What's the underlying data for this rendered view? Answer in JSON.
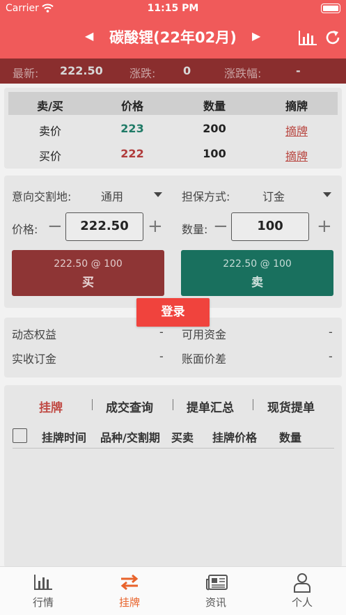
{
  "status": {
    "carrier": "Carrier",
    "time": "11:15 PM"
  },
  "nav": {
    "title": "碳酸锂(22年02月)",
    "prev_icon": "caret-left-icon",
    "next_icon": "caret-right-icon",
    "chart_icon": "bar-chart-icon",
    "refresh_icon": "refresh-icon"
  },
  "quote": {
    "latest_label": "最新:",
    "latest_value": "222.50",
    "change_label": "涨跌:",
    "change_value": "0",
    "pct_label": "涨跌幅:",
    "pct_value": "-"
  },
  "book": {
    "headers": [
      "卖/买",
      "价格",
      "数量",
      "摘牌"
    ],
    "rows": [
      {
        "side": "卖价",
        "price": "223",
        "qty": "200",
        "action": "摘牌"
      },
      {
        "side": "买价",
        "price": "222",
        "qty": "100",
        "action": "摘牌"
      }
    ]
  },
  "form": {
    "delivery_label": "意向交割地:",
    "delivery_value": "通用",
    "guarantee_label": "担保方式:",
    "guarantee_value": "订金",
    "price_label": "价格:",
    "price_value": "222.50",
    "qty_label": "数量:",
    "qty_value": "100",
    "buy_sub": "222.50 @ 100",
    "buy_label": "买",
    "sell_sub": "222.50 @ 100",
    "sell_label": "卖"
  },
  "login_label": "登录",
  "account": {
    "equity_label": "动态权益",
    "equity_value": "-",
    "avail_label": "可用资金",
    "avail_value": "-",
    "deposit_label": "实收订金",
    "deposit_value": "-",
    "diff_label": "账面价差",
    "diff_value": "-"
  },
  "tabs": [
    "挂牌",
    "成交查询",
    "提单汇总",
    "现货提单"
  ],
  "columns": [
    "挂牌时间",
    "品种/交割期",
    "买卖",
    "挂牌价格",
    "数量"
  ],
  "tabbar": [
    "行情",
    "挂牌",
    "资讯",
    "个人"
  ],
  "colors": {
    "header": "#f05a5a",
    "accent": "#e8632b",
    "buy": "#8e3535",
    "sell": "#19705e",
    "login": "#f0433d"
  }
}
